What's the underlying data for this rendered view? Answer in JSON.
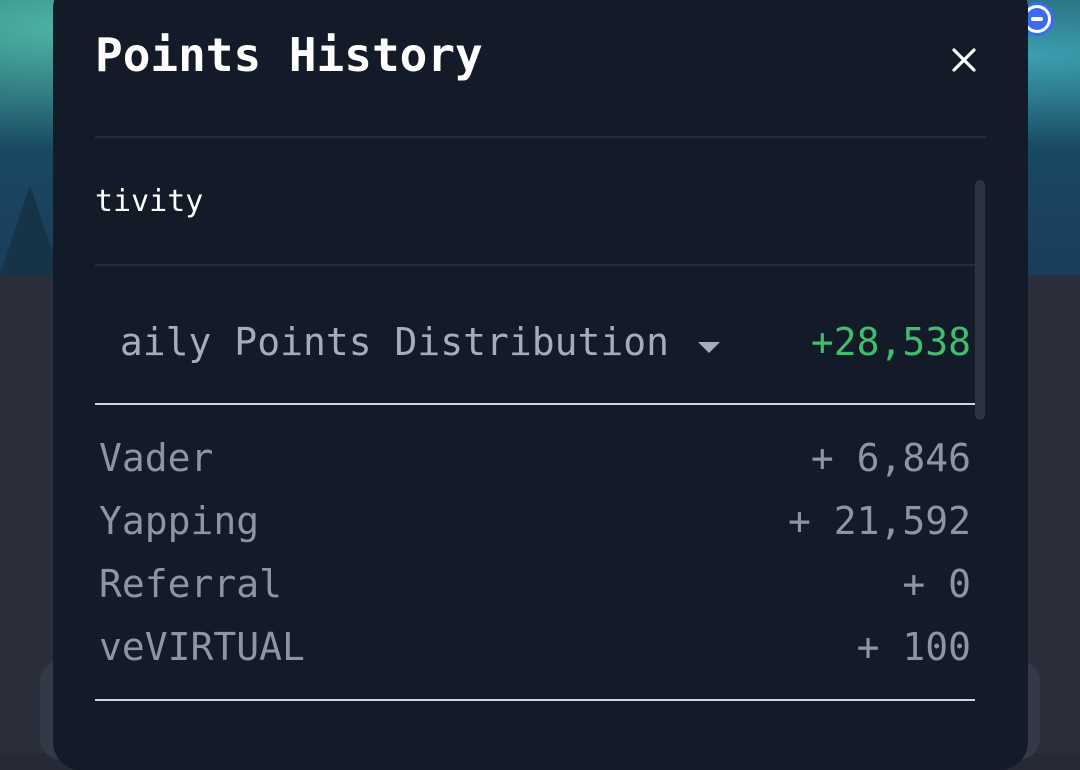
{
  "modal": {
    "title": "Points History",
    "close_icon": "close-icon"
  },
  "activity": {
    "label": "tivity"
  },
  "distribution": {
    "label": "aily Points Distribution",
    "caret_icon": "caret-down-icon",
    "total": "+28,538",
    "total_color": "#3fbf6e",
    "items": [
      {
        "name": "Vader",
        "value": "+ 6,846"
      },
      {
        "name": "Yapping",
        "value": "+ 21,592"
      },
      {
        "name": "Referral",
        "value": "+ 0"
      },
      {
        "name": "veVIRTUAL",
        "value": "+ 100"
      }
    ]
  },
  "background": {
    "corner_icon": "wallet-icon"
  }
}
